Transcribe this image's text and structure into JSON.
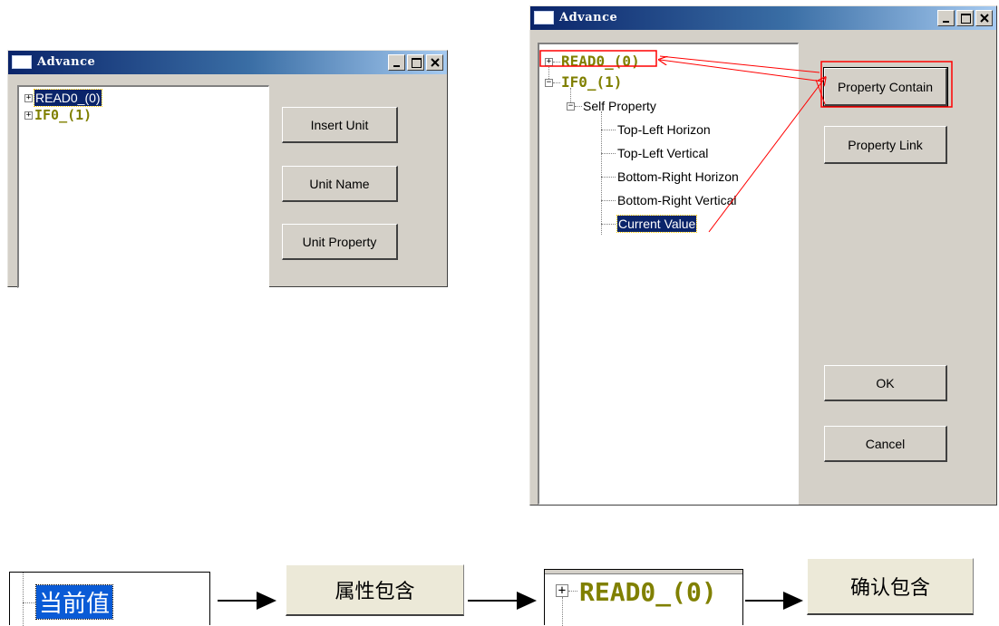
{
  "left_window": {
    "title": "Advance",
    "tree": [
      {
        "label": "READ0_(0)",
        "selected": true
      },
      {
        "label": "IF0_(1)",
        "selected": false
      }
    ],
    "buttons": [
      "Insert Unit",
      "Unit Name",
      "Unit Property"
    ]
  },
  "right_window": {
    "title": "Advance",
    "tree": {
      "read0": "READ0_(0)",
      "if0": "IF0_(1)",
      "self_property": "Self Property",
      "children": [
        "Top-Left Horizon",
        "Top-Left Vertical",
        "Bottom-Right Horizon",
        "Bottom-Right Vertical",
        "Current Value"
      ]
    },
    "buttons": {
      "property_contain": "Property Contain",
      "property_link": "Property Link",
      "ok": "OK",
      "cancel": "Cancel"
    }
  },
  "bottom_flow": {
    "step1": "当前值",
    "step2": "属性包含",
    "step3": "READ0_(0)",
    "step4": "确认包含"
  },
  "colors": {
    "annotation": "#ff0000",
    "tree_olive": "#808000",
    "selection": "#0a246a"
  }
}
